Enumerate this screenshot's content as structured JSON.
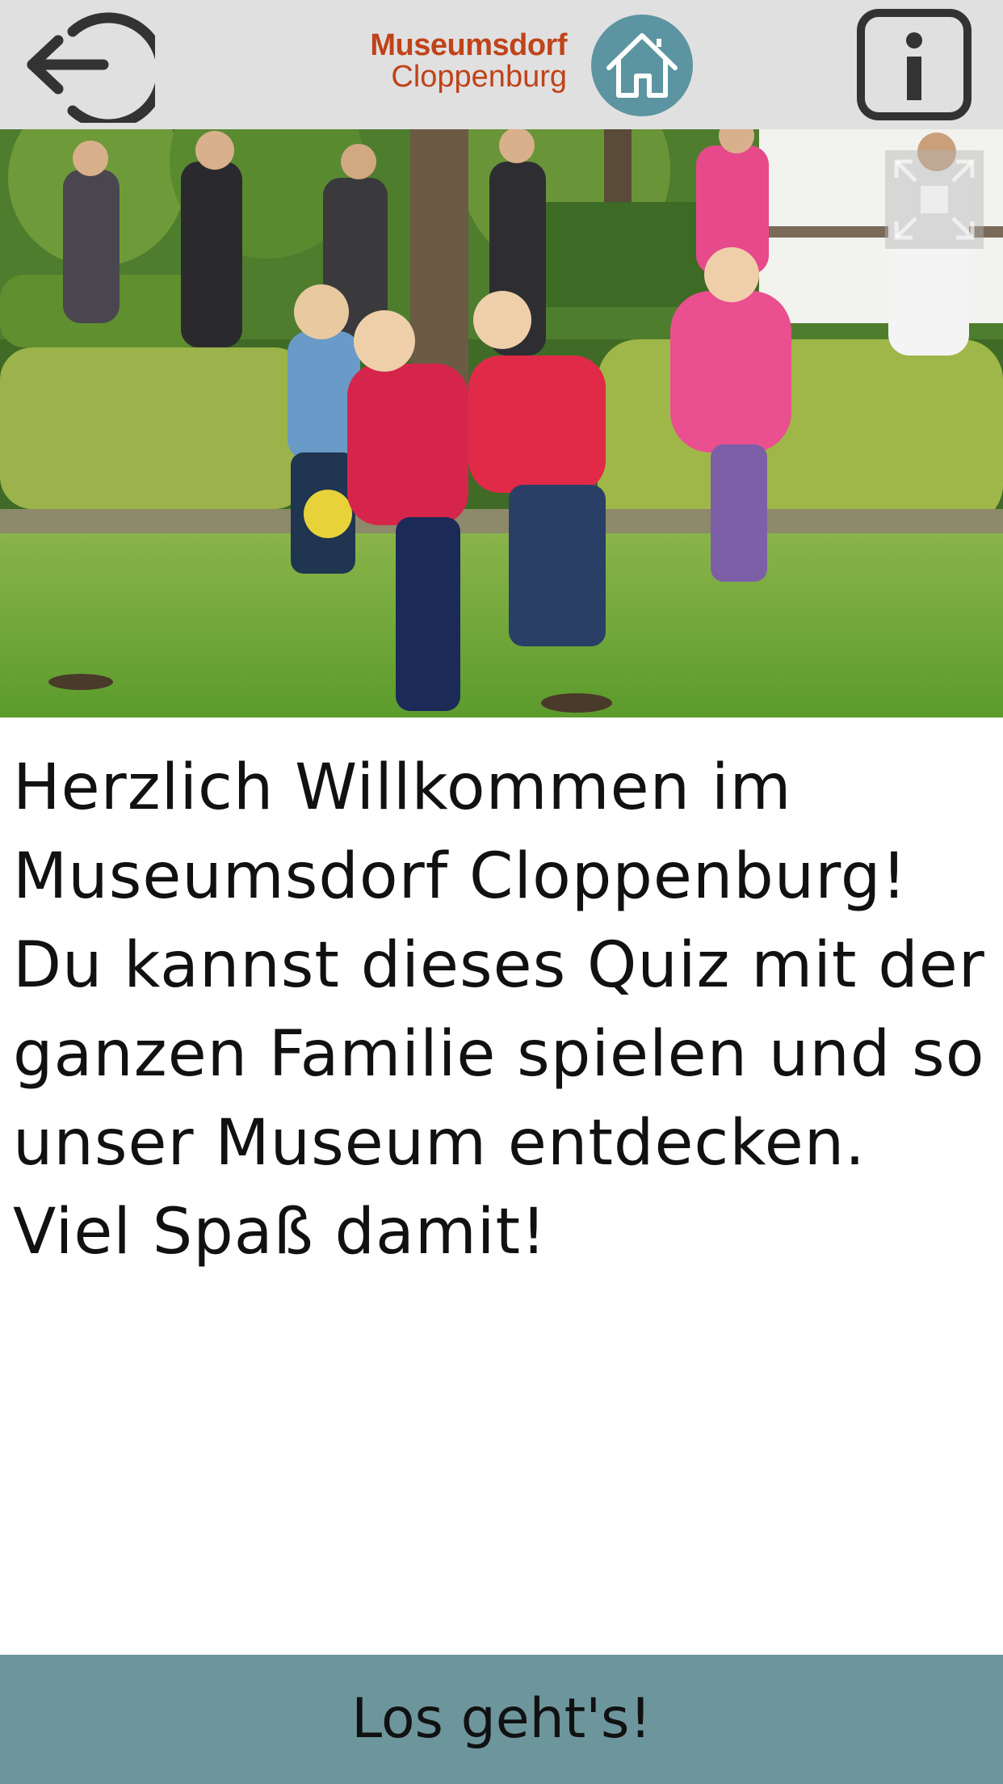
{
  "header": {
    "back_icon": "logout-arrow-icon",
    "logo_line1": "Museumsdorf",
    "logo_line2": "Cloppenburg",
    "home_icon": "house-icon",
    "info_icon": "info-icon",
    "colors": {
      "bar": "#e0e0e0",
      "logo_text": "#c0431a",
      "logo_circle": "#5c95a1"
    }
  },
  "hero": {
    "image": "photo of children running on a lawn in a park with adults behind",
    "fullscreen_icon": "fullscreen-icon"
  },
  "welcome_text": "Herzlich Willkommen im Museumsdorf Cloppenburg! Du kannst dieses Quiz mit der ganzen Familie spielen und so unser Museum entdecken. Viel Spaß damit!",
  "start_button": {
    "label": "Los geht's!",
    "color": "#6d969c"
  }
}
